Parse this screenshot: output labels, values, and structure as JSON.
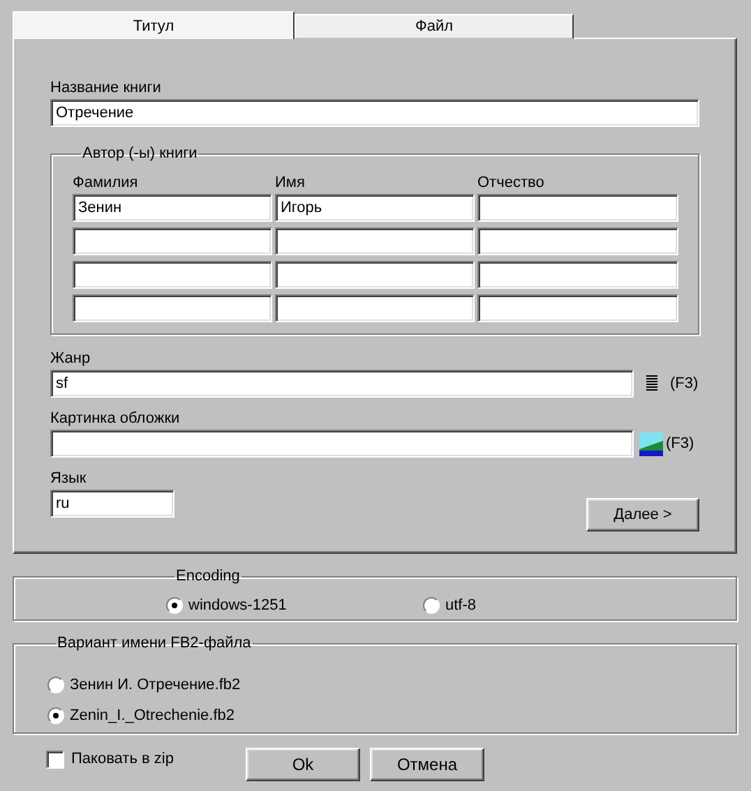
{
  "tabs": [
    {
      "label": "Титул",
      "selected": true
    },
    {
      "label": "Файл",
      "selected": false
    }
  ],
  "book_title": {
    "label": "Название книги",
    "value": "Отречение"
  },
  "authors": {
    "title": "Автор (-ы) книги",
    "columns": [
      "Фамилия",
      "Имя",
      "Отчество"
    ],
    "rows": [
      {
        "cells": [
          "Зенин",
          "Игорь"
        ]
      },
      {
        "cells": []
      },
      {
        "cells": []
      },
      {
        "cells": []
      }
    ]
  },
  "genre": {
    "label": "Жанр",
    "value": "sf",
    "hint": "(F3)"
  },
  "cover": {
    "label": "Картинка обложки",
    "hint": "(F3)"
  },
  "language": {
    "label": "Язык",
    "value": "ru"
  },
  "next_button": "Далее >",
  "encoding": {
    "title": "Encoding",
    "options": [
      {
        "label": "windows-1251",
        "selected": true
      },
      {
        "label": "utf-8",
        "selected": false
      }
    ]
  },
  "filename_variant": {
    "title": "Вариант имени FB2-файла",
    "options": [
      {
        "label": "Зенин И. Отречение.fb2",
        "selected": false
      },
      {
        "label": "Zenin_I._Otrechenie.fb2",
        "selected": true
      }
    ]
  },
  "zip": {
    "label": "Паковать в zip",
    "checked": false
  },
  "buttons": [
    "Ok",
    "Отмена"
  ]
}
